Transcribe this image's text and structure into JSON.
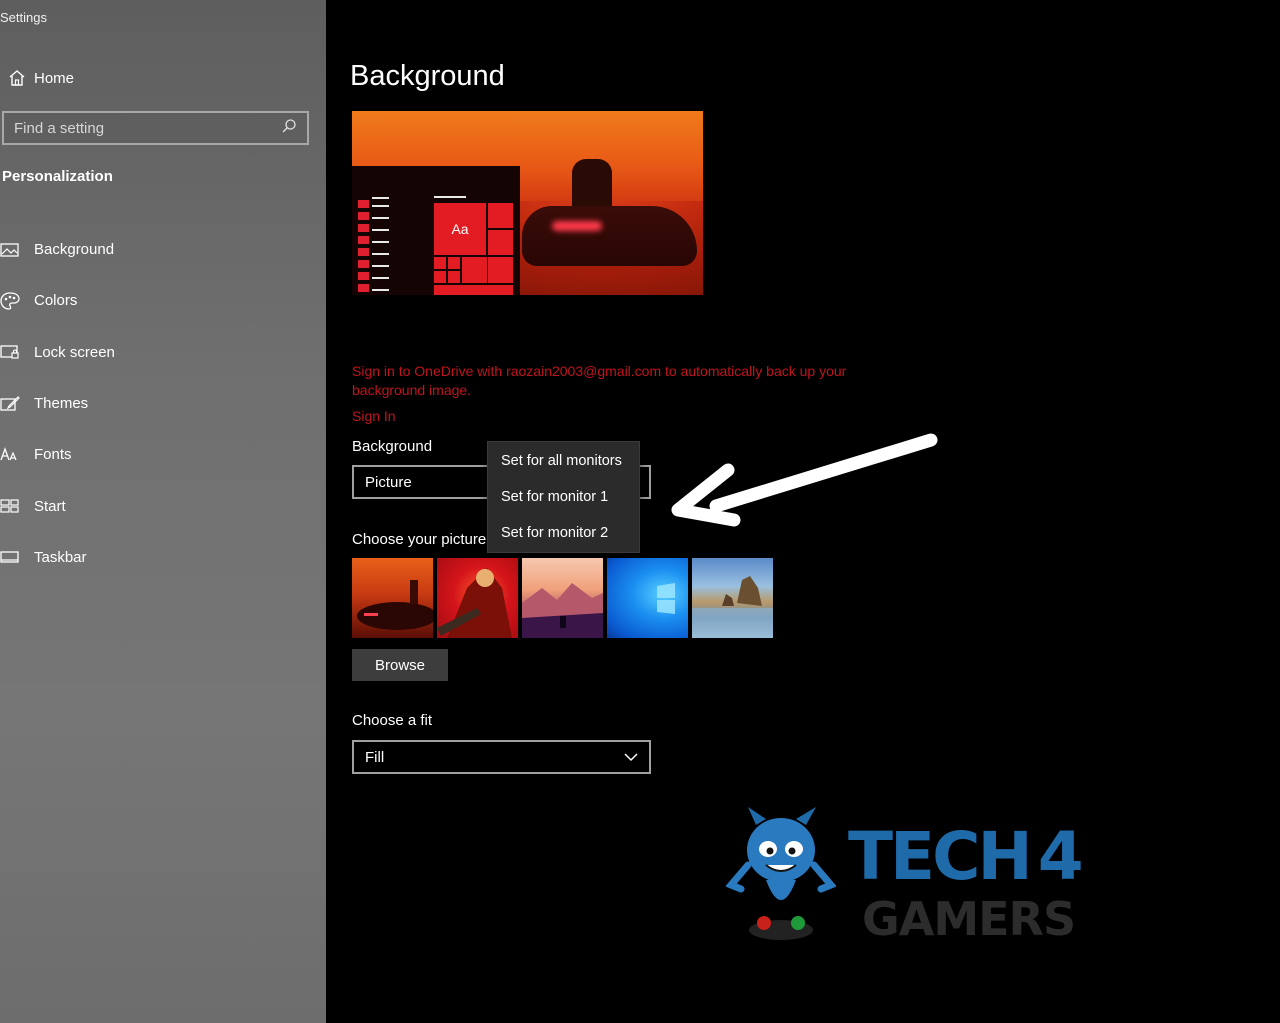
{
  "window": {
    "title": "Settings"
  },
  "sidebar": {
    "home_label": "Home",
    "search_placeholder": "Find a setting",
    "section_label": "Personalization",
    "items": [
      {
        "label": "Background",
        "icon": "picture-icon"
      },
      {
        "label": "Colors",
        "icon": "palette-icon"
      },
      {
        "label": "Lock screen",
        "icon": "lock-screen-icon"
      },
      {
        "label": "Themes",
        "icon": "themes-brush-icon"
      },
      {
        "label": "Fonts",
        "icon": "fonts-icon"
      },
      {
        "label": "Start",
        "icon": "start-grid-icon"
      },
      {
        "label": "Taskbar",
        "icon": "taskbar-icon"
      }
    ]
  },
  "main": {
    "title": "Background",
    "preview_tile_text": "Aa",
    "onedrive_message": "Sign in to OneDrive with raozain2003@gmail.com to automatically back up your background image.",
    "sign_in_label": "Sign In",
    "background_label": "Background",
    "background_value": "Picture",
    "context_menu": [
      "Set for all monitors",
      "Set for monitor 1",
      "Set for monitor 2"
    ],
    "choose_picture_label": "Choose your picture",
    "browse_label": "Browse",
    "choose_fit_label": "Choose a fit",
    "fit_value": "Fill"
  },
  "watermark": {
    "line1": "TECH",
    "number": "4",
    "line2": "GAMERS"
  },
  "colors": {
    "accent": "#e31b23",
    "warning_text": "#c0141e",
    "logo_blue": "#1f6aa8"
  }
}
